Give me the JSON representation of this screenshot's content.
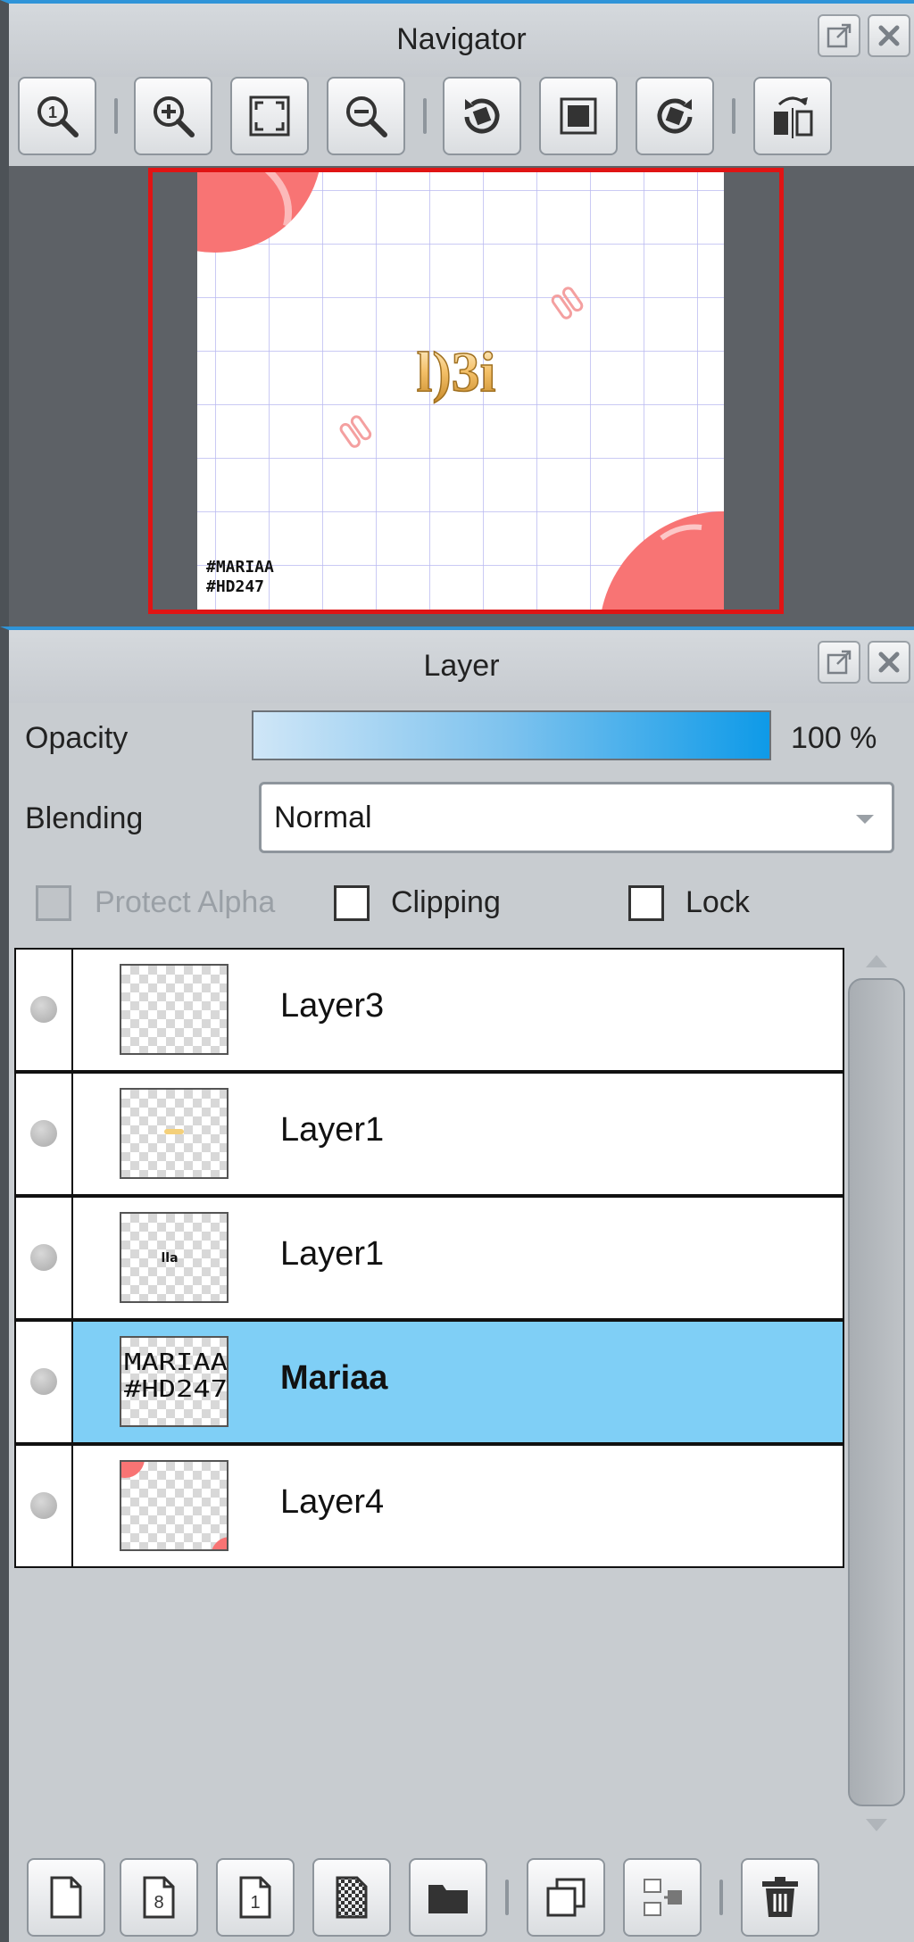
{
  "navigator": {
    "title": "Navigator",
    "toolbar": [
      {
        "name": "zoom-actual-size-icon"
      },
      {
        "name": "zoom-in-icon"
      },
      {
        "name": "fit-to-window-icon"
      },
      {
        "name": "zoom-out-icon"
      },
      {
        "name": "rotate-left-icon"
      },
      {
        "name": "reset-rotation-icon"
      },
      {
        "name": "rotate-right-icon"
      },
      {
        "name": "flip-horizontal-icon"
      }
    ],
    "preview": {
      "artwork_text": "l)3i",
      "watermark_line1": "#MARIAA",
      "watermark_line2": "#HD247"
    },
    "frame_color": "#e01414"
  },
  "layer": {
    "title": "Layer",
    "opacity_label": "Opacity",
    "opacity_value": "100 %",
    "opacity_fraction": 1.0,
    "blending_label": "Blending",
    "blending_value": "Normal",
    "protect_alpha_label": "Protect Alpha",
    "clipping_label": "Clipping",
    "lock_label": "Lock",
    "layers": [
      {
        "name": "Layer3",
        "selected": false
      },
      {
        "name": "Layer1",
        "selected": false
      },
      {
        "name": "Layer1",
        "selected": false
      },
      {
        "name": "Mariaa",
        "selected": true,
        "thumb_line1": "MARIAA",
        "thumb_line2": "#HD247"
      },
      {
        "name": "Layer4",
        "selected": false
      }
    ],
    "thumb_small_text": "lla",
    "selected_color": "#7fcff6",
    "accent_color": "#0e9ae8",
    "bottom_toolbar": [
      {
        "name": "new-layer-icon"
      },
      {
        "name": "new-8bit-layer-icon"
      },
      {
        "name": "new-1bit-layer-icon"
      },
      {
        "name": "new-halftone-layer-icon"
      },
      {
        "name": "new-folder-icon"
      },
      {
        "name": "duplicate-layer-icon"
      },
      {
        "name": "merge-down-icon"
      },
      {
        "name": "delete-layer-icon"
      }
    ]
  }
}
